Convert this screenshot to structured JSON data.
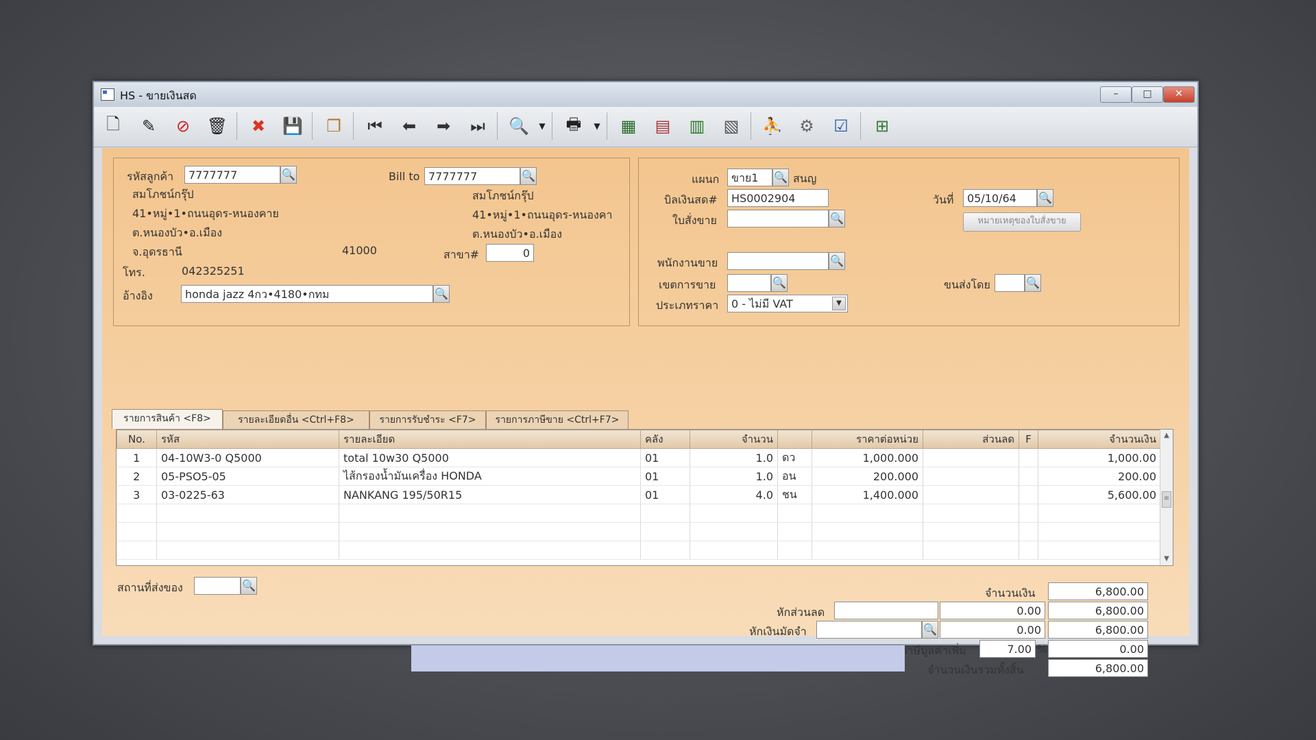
{
  "window": {
    "title": "HS - ขายเงินสด",
    "min": "–",
    "max": "□",
    "close": "✕"
  },
  "customer": {
    "code_label": "รหัสลูกค้า",
    "code": "7777777",
    "name": "สมโภชน์กรุ๊ป",
    "addr1": "41•หมู่•1•ถนนอุดร-หนองคาย",
    "addr2": "ต.หนองบัว•อ.เมือง",
    "addr3": "จ.อุดรธานี",
    "zip": "41000",
    "tel_label": "โทร.",
    "tel": "042325251",
    "ref_label": "อ้างอิง",
    "ref": "honda jazz 4กว•4180•กทม"
  },
  "billto": {
    "label": "Bill to",
    "code": "7777777",
    "name": "สมโภชน์กรุ๊ป",
    "addr1": "41•หมู่•1•ถนนอุดร-หนองคา",
    "addr2": "ต.หนองบัว•อ.เมือง",
    "branch_label": "สาขา#",
    "branch": "0"
  },
  "doc": {
    "dept_label": "แผนก",
    "dept": "ขาย1",
    "dept_name": "สนญ",
    "bill_label": "บิลเงินสด#",
    "bill_no": "HS0002904",
    "date_label": "วันที่",
    "date": "05/10/64",
    "order_label": "ใบสั่งขาย",
    "order": "",
    "note_button": "หมายเหตุของใบสั่งขาย",
    "sales_label": "พนักงานขาย",
    "sales": "",
    "zone_label": "เขตการขาย",
    "zone": "",
    "ship_by_label": "ขนส่งโดย",
    "ship_by": "",
    "price_label": "ประเภทราคา",
    "price_type": "0 - ไม่มี VAT"
  },
  "tabs": [
    "รายการสินค้า <F8>",
    "รายละเอียดอื่น <Ctrl+F8>",
    "รายการรับชำระ <F7>",
    "รายการภาษีขาย <Ctrl+F7>"
  ],
  "grid": {
    "headers": [
      "No.",
      "รหัส",
      "รายละเอียด",
      "คลัง",
      "จำนวน",
      "",
      "ราคาต่อหน่วย",
      "ส่วนลด",
      "F",
      "จำนวนเงิน"
    ],
    "rows": [
      [
        "1",
        "04-10W3-0 Q5000",
        "total 10w30 Q5000",
        "01",
        "1.0",
        "ดว",
        "1,000.000",
        "",
        "",
        "1,000.00"
      ],
      [
        "2",
        "05-PSO5-05",
        "ไส้กรองน้ำมันเครื่อง HONDA",
        "01",
        "1.0",
        "อน",
        "200.000",
        "",
        "",
        "200.00"
      ],
      [
        "3",
        "03-0225-63",
        "NANKANG 195/50R15",
        "01",
        "4.0",
        "ชน",
        "1,400.000",
        "",
        "",
        "5,600.00"
      ]
    ]
  },
  "footer": {
    "ship_place_label": "สถานที่ส่งของ",
    "ship_place": "",
    "amount_label": "จำนวนเงิน",
    "amount": "6,800.00",
    "discount_label": "หักส่วนลด",
    "discount_text": "",
    "discount": "0.00",
    "after_discount": "6,800.00",
    "deposit_label": "หักเงินมัดจำ",
    "deposit_text": "",
    "deposit": "0.00",
    "after_deposit": "6,800.00",
    "vat_label": "ภาษีมูลค่าเพิ่ม",
    "vat_rate": "7.00",
    "vat_pct": "%",
    "vat": "0.00",
    "total_label": "จำนวนเงินรวมทั้งสิ้น",
    "total": "6,800.00"
  }
}
